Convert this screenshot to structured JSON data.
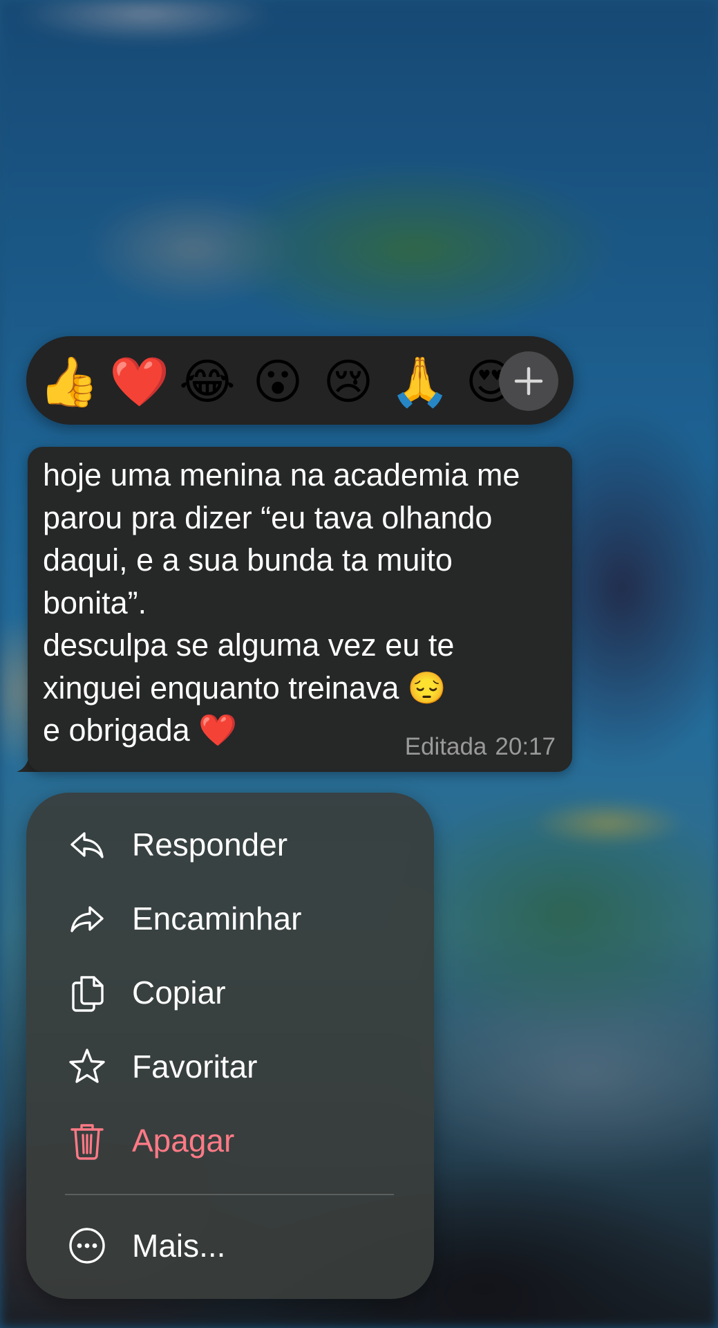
{
  "reactions": {
    "items": [
      "👍",
      "❤️",
      "😂",
      "😮",
      "😢",
      "🙏",
      "😍"
    ],
    "add_icon": "plus-icon"
  },
  "message": {
    "text": "hoje uma menina na academia me\nparou pra dizer “eu tava olhando\ndaqui, e a sua bunda ta muito\nbonita”.\ndesculpa se alguma vez eu te\nxinguei enquanto treinava 😔\ne obrigada ❤️",
    "edited_label": "Editada",
    "time": "20:17"
  },
  "menu": {
    "items": [
      {
        "label": "Responder",
        "icon": "reply-icon"
      },
      {
        "label": "Encaminhar",
        "icon": "forward-icon"
      },
      {
        "label": "Copiar",
        "icon": "copy-icon"
      },
      {
        "label": "Favoritar",
        "icon": "star-icon"
      },
      {
        "label": "Apagar",
        "icon": "trash-icon",
        "danger": true
      },
      {
        "label": "Mais...",
        "icon": "more-icon"
      }
    ]
  },
  "colors": {
    "danger": "#ff7a86",
    "bubble": "#262727",
    "menu_bg": "#3a3e3c"
  }
}
